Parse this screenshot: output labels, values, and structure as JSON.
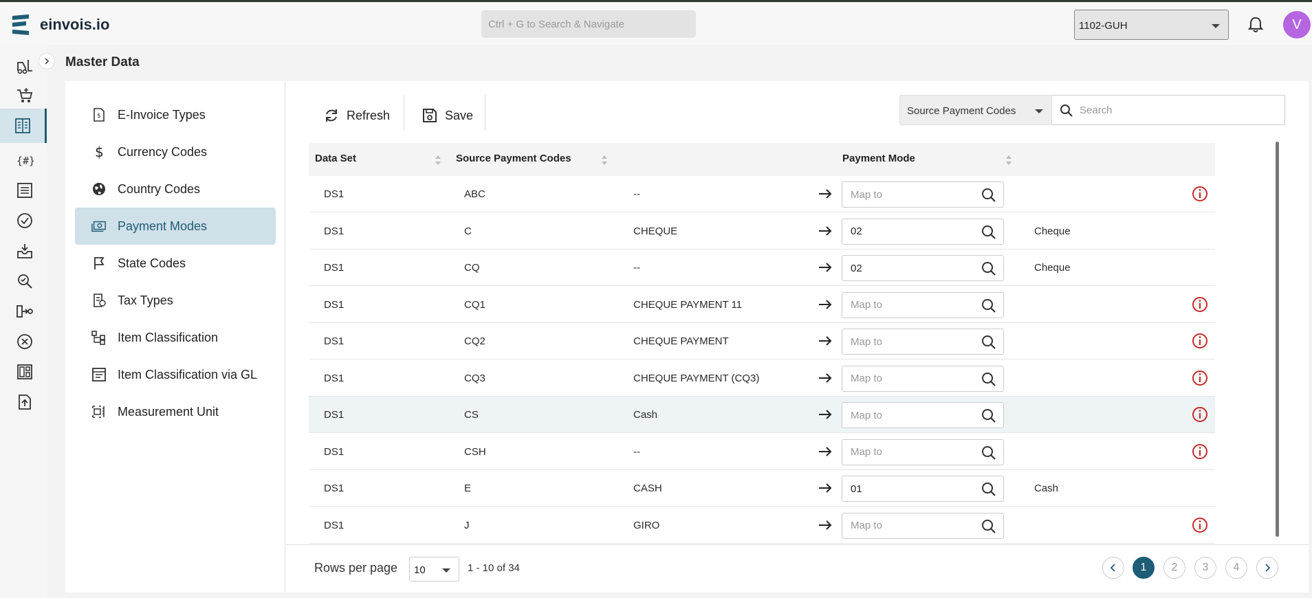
{
  "app": {
    "brand": "einvois.io",
    "avatar_initial": "V"
  },
  "topbar": {
    "search_placeholder": "Ctrl + G to Search & Navigate",
    "company": "1102-GUH"
  },
  "page": {
    "title": "Master Data"
  },
  "nav": {
    "items": [
      {
        "label": "E-Invoice Types",
        "icon": "invoice-icon",
        "active": false
      },
      {
        "label": "Currency Codes",
        "icon": "dollar-icon",
        "active": false
      },
      {
        "label": "Country Codes",
        "icon": "globe-icon",
        "active": false
      },
      {
        "label": "Payment Modes",
        "icon": "cash-icon",
        "active": true
      },
      {
        "label": "State Codes",
        "icon": "flag-icon",
        "active": false
      },
      {
        "label": "Tax Types",
        "icon": "tax-icon",
        "active": false
      },
      {
        "label": "Item Classification",
        "icon": "hierarchy-icon",
        "active": false
      },
      {
        "label": "Item Classification via GL",
        "icon": "ledger-icon",
        "active": false
      },
      {
        "label": "Measurement Unit",
        "icon": "ruler-icon",
        "active": false
      }
    ]
  },
  "toolbar": {
    "refresh_label": "Refresh",
    "save_label": "Save",
    "filter_field": "Source Payment Codes",
    "search_placeholder": "Search"
  },
  "table": {
    "headers": {
      "data_set": "Data Set",
      "source_codes": "Source Payment Codes",
      "payment_mode": "Payment Mode"
    },
    "map_placeholder": "Map to",
    "rows": [
      {
        "data_set": "DS1",
        "code": "ABC",
        "description": "--",
        "mode": "",
        "mode_name": "",
        "warning": true
      },
      {
        "data_set": "DS1",
        "code": "C",
        "description": "CHEQUE",
        "mode": "02",
        "mode_name": "Cheque",
        "warning": false
      },
      {
        "data_set": "DS1",
        "code": "CQ",
        "description": "--",
        "mode": "02",
        "mode_name": "Cheque",
        "warning": false
      },
      {
        "data_set": "DS1",
        "code": "CQ1",
        "description": "CHEQUE PAYMENT 11",
        "mode": "",
        "mode_name": "",
        "warning": true
      },
      {
        "data_set": "DS1",
        "code": "CQ2",
        "description": "CHEQUE PAYMENT",
        "mode": "",
        "mode_name": "",
        "warning": true
      },
      {
        "data_set": "DS1",
        "code": "CQ3",
        "description": "CHEQUE PAYMENT (CQ3)",
        "mode": "",
        "mode_name": "",
        "warning": true
      },
      {
        "data_set": "DS1",
        "code": "CS",
        "description": "Cash",
        "mode": "",
        "mode_name": "",
        "warning": true
      },
      {
        "data_set": "DS1",
        "code": "CSH",
        "description": "--",
        "mode": "",
        "mode_name": "",
        "warning": true
      },
      {
        "data_set": "DS1",
        "code": "E",
        "description": "CASH",
        "mode": "01",
        "mode_name": "Cash",
        "warning": false
      },
      {
        "data_set": "DS1",
        "code": "J",
        "description": "GIRO",
        "mode": "",
        "mode_name": "",
        "warning": true
      }
    ]
  },
  "pagination": {
    "rows_per_page_label": "Rows per page",
    "rows_per_page": "10",
    "range": "1 - 10 of 34",
    "pages": [
      "1",
      "2",
      "3",
      "4"
    ],
    "current_page": "1"
  },
  "colors": {
    "accent": "#1f5c75",
    "warning": "#c62828",
    "active_nav_bg": "#cfe0e8"
  }
}
